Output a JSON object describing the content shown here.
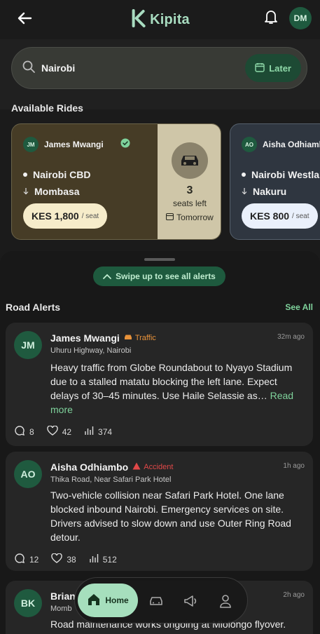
{
  "header": {
    "app_name": "Kipita",
    "user_initials": "DM"
  },
  "search": {
    "value": "Nairobi",
    "later_label": "Later"
  },
  "available_rides": {
    "title": "Available Rides",
    "rides": [
      {
        "initials": "JM",
        "driver": "James Mwangi",
        "from": "Nairobi CBD",
        "to": "Mombasa",
        "price": "KES 1,800",
        "per": "/ seat",
        "seats": "3",
        "seats_label": "seats left",
        "when": "Tomorrow"
      },
      {
        "initials": "AO",
        "driver": "Aisha Odhiambo",
        "from": "Nairobi Westlands",
        "to": "Nakuru",
        "price": "KES 800",
        "per": "/ seat"
      }
    ]
  },
  "sheet": {
    "swipe_label": "Swipe up to see all alerts",
    "alerts_title": "Road Alerts",
    "see_all": "See All"
  },
  "alerts": [
    {
      "initials": "JM",
      "name": "James Mwangi",
      "tag": "Traffic",
      "time": "32m ago",
      "location": "Uhuru Highway, Nairobi",
      "body": "Heavy traffic from Globe Roundabout to Nyayo Stadium due to a stalled matatu blocking the left lane. Expect delays of 30–45 minutes. Use Haile Selassie as…",
      "read_more": "Read more",
      "comments": "8",
      "likes": "42",
      "views": "374"
    },
    {
      "initials": "AO",
      "name": "Aisha Odhiambo",
      "tag": "Accident",
      "time": "1h ago",
      "location": "Thika Road, Near Safari Park Hotel",
      "body": "Two-vehicle collision near Safari Park Hotel. One lane blocked inbound Nairobi. Emergency services on site. Drivers advised to slow down and use Outer Ring Road detour.",
      "comments": "12",
      "likes": "38",
      "views": "512"
    },
    {
      "initials": "BK",
      "name": "Brian",
      "time": "2h ago",
      "location": "Momb",
      "body": "Road maintenance works ongoing at Mlolongo flyover."
    }
  ],
  "nav": {
    "home_label": "Home"
  },
  "colors": {
    "accent": "#7fd39c",
    "traffic": "#e8923a",
    "accident": "#e04848"
  }
}
